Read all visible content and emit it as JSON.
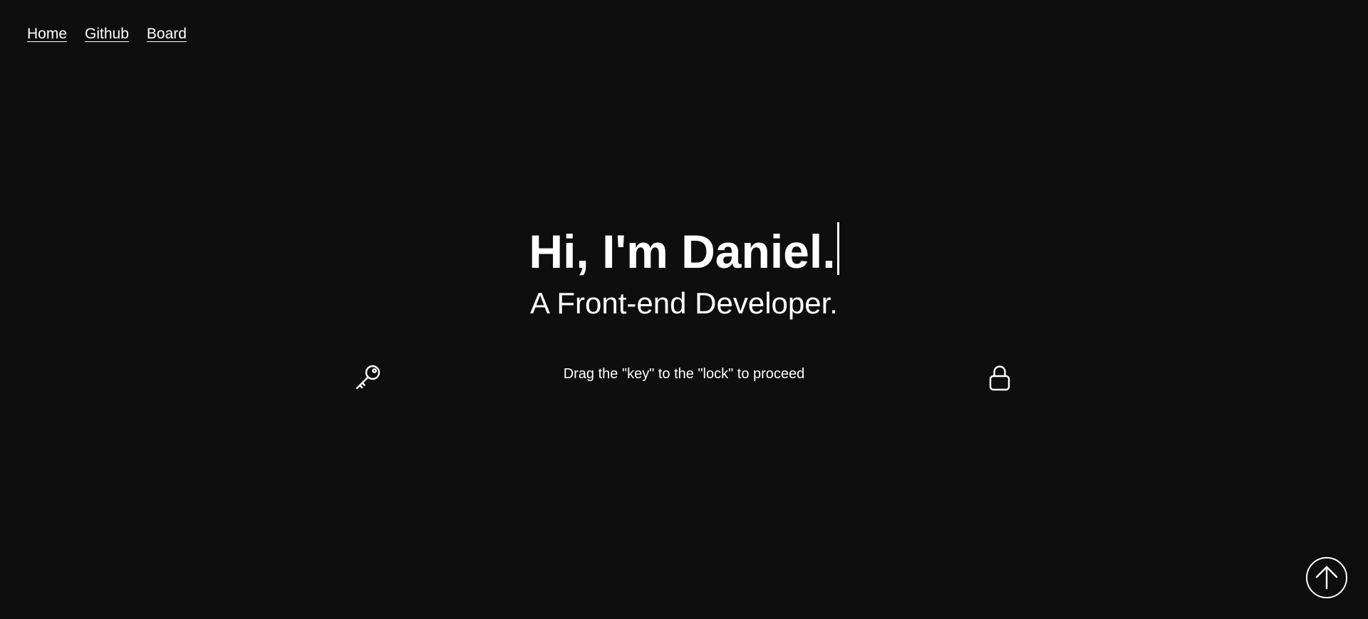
{
  "nav": {
    "items": [
      {
        "label": "Home"
      },
      {
        "label": "Github"
      },
      {
        "label": "Board"
      }
    ]
  },
  "hero": {
    "title": "Hi, I'm Daniel.",
    "subtitle": "A Front-end Developer."
  },
  "unlock": {
    "hint": "Drag the \"key\" to the \"lock\" to proceed",
    "key_icon": "key-icon",
    "lock_icon": "lock-icon"
  },
  "scroll_top": {
    "icon": "arrow-up-icon"
  },
  "colors": {
    "background": "#0e0e0e",
    "foreground": "#ffffff"
  }
}
